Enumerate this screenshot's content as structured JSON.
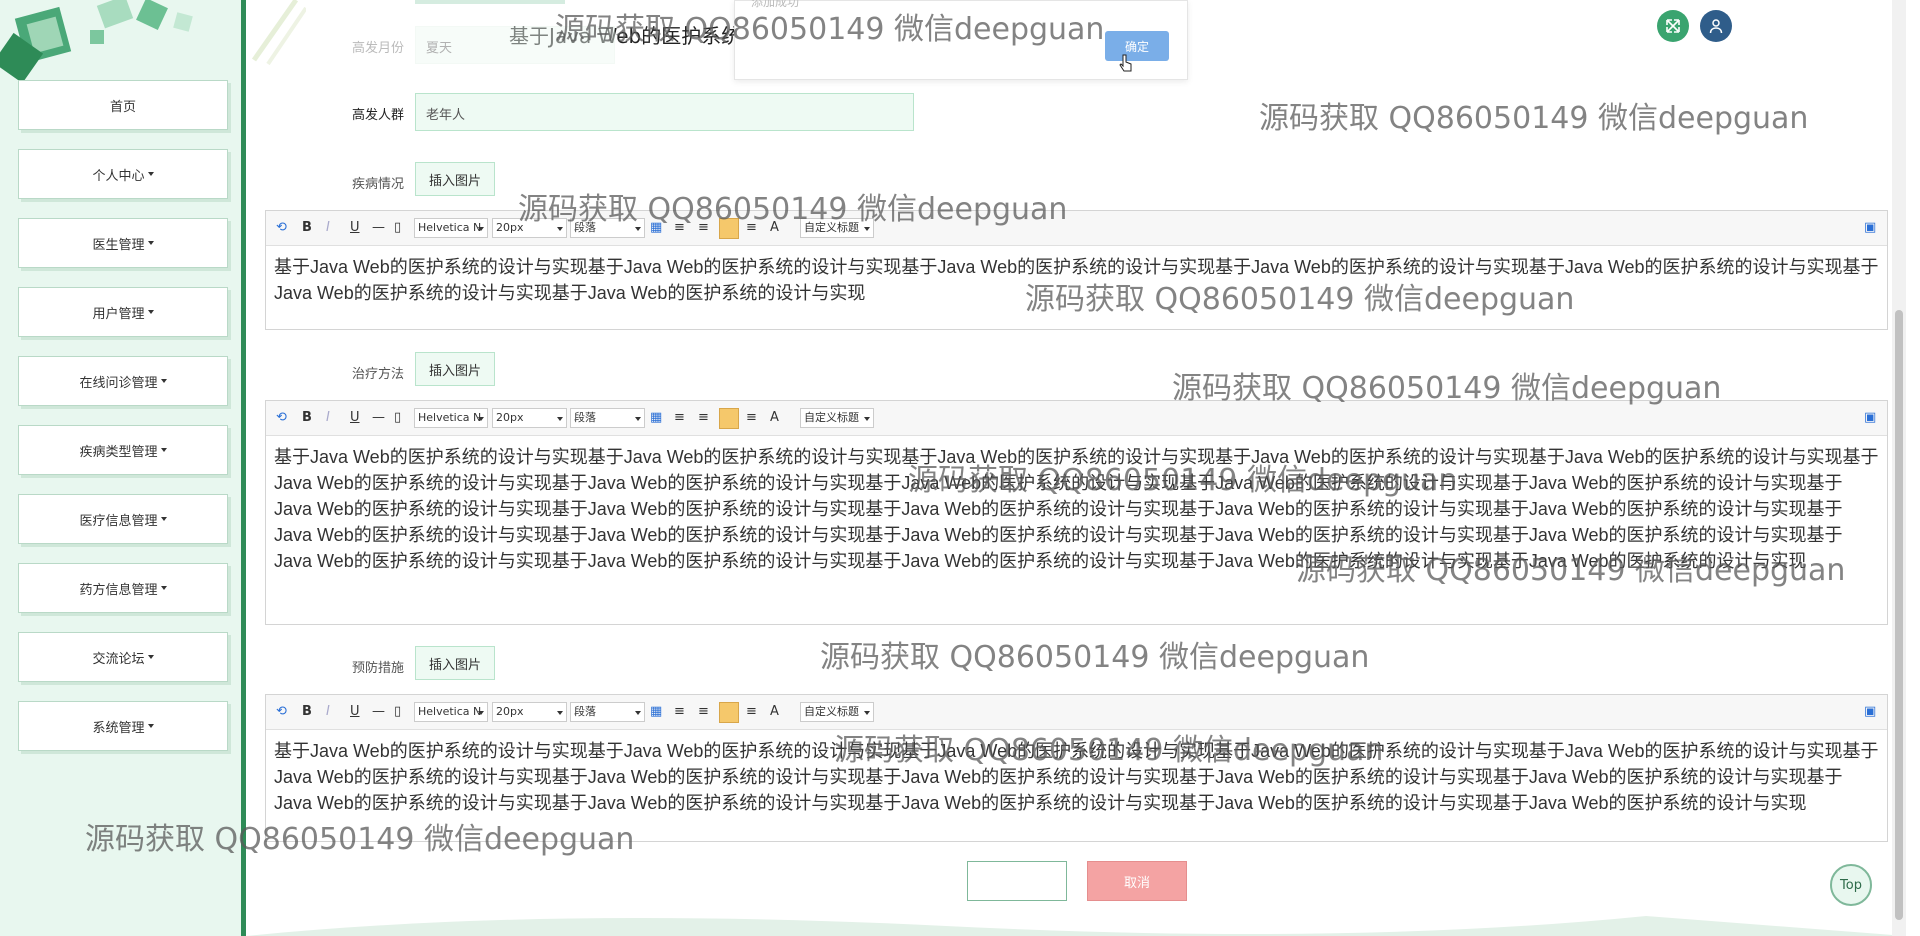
{
  "sidebar": {
    "items": [
      {
        "label": "首页",
        "has_caret": false
      },
      {
        "label": "个人中心",
        "has_caret": true
      },
      {
        "label": "医生管理",
        "has_caret": true
      },
      {
        "label": "用户管理",
        "has_caret": true
      },
      {
        "label": "在线问诊管理",
        "has_caret": true
      },
      {
        "label": "疾病类型管理",
        "has_caret": true
      },
      {
        "label": "医疗信息管理",
        "has_caret": true
      },
      {
        "label": "药方信息管理",
        "has_caret": true
      },
      {
        "label": "交流论坛",
        "has_caret": true
      },
      {
        "label": "系统管理",
        "has_caret": true
      }
    ]
  },
  "header": {
    "title": "基于Java Web的医护系统的设计与实现",
    "fullscreen_icon": "fullscreen-icon",
    "user_icon": "user-icon"
  },
  "popup": {
    "label": "添加成功",
    "confirm_label": "确定"
  },
  "form": {
    "season": {
      "label": "高发月份",
      "value": "夏天"
    },
    "population": {
      "label": "高发人群",
      "value": "老年人"
    },
    "condition": {
      "label": "疾病情况",
      "insert_image_label": "插入图片",
      "text": "基于Java Web的医护系统的设计与实现基于Java Web的医护系统的设计与实现基于Java Web的医护系统的设计与实现基于Java Web的医护系统的设计与实现基于Java Web的医护系统的设计与实现基于Java Web的医护系统的设计与实现基于Java Web的医护系统的设计与实现"
    },
    "treatment": {
      "label": "治疗方法",
      "insert_image_label": "插入图片",
      "text": "基于Java Web的医护系统的设计与实现基于Java Web的医护系统的设计与实现基于Java Web的医护系统的设计与实现基于Java Web的医护系统的设计与实现基于Java Web的医护系统的设计与实现基于Java Web的医护系统的设计与实现基于Java Web的医护系统的设计与实现基于Java Web的医护系统的设计与实现基于Java Web的医护系统的设计与实现基于Java Web的医护系统的设计与实现基于Java Web的医护系统的设计与实现基于Java Web的医护系统的设计与实现基于Java Web的医护系统的设计与实现基于Java Web的医护系统的设计与实现基于Java Web的医护系统的设计与实现基于Java Web的医护系统的设计与实现基于Java Web的医护系统的设计与实现基于Java Web的医护系统的设计与实现基于Java Web的医护系统的设计与实现基于Java Web的医护系统的设计与实现基于Java Web的医护系统的设计与实现基于Java Web的医护系统的设计与实现基于Java Web的医护系统的设计与实现基于Java Web的医护系统的设计与实现基于Java Web的医护系统的设计与实现"
    },
    "prevention": {
      "label": "预防措施",
      "insert_image_label": "插入图片",
      "text": "基于Java Web的医护系统的设计与实现基于Java Web的医护系统的设计与实现基于Java Web的医护系统的设计与实现基于Java Web的医护系统的设计与实现基于Java Web的医护系统的设计与实现基于Java Web的医护系统的设计与实现基于Java Web的医护系统的设计与实现基于Java Web的医护系统的设计与实现基于Java Web的医护系统的设计与实现基于Java Web的医护系统的设计与实现基于Java Web的医护系统的设计与实现基于Java Web的医护系统的设计与实现基于Java Web的医护系统的设计与实现基于Java Web的医护系统的设计与实现基于Java Web的医护系统的设计与实现"
    },
    "submit_label": "",
    "cancel_label": "取消"
  },
  "toolbar": {
    "font_family": "Helvetica N",
    "font_size": "20px",
    "paragraph": "段落",
    "custom_title": "自定义标题",
    "bold": "B",
    "italic": "I",
    "underline": "U",
    "font_color": "A"
  },
  "watermark": "源码获取 QQ86050149 微信deepguan",
  "top_button": "Top",
  "colors": {
    "accent": "#2e8b57",
    "cancel": "#f4a3a3",
    "confirm": "#7aaee8"
  }
}
